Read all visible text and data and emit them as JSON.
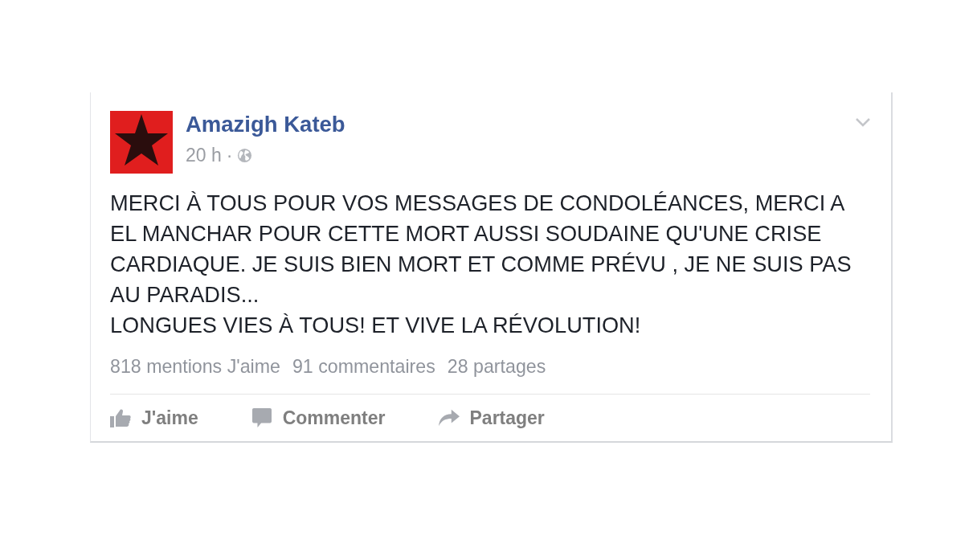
{
  "post": {
    "author": "Amazigh Kateb",
    "time": "20 h",
    "separator": "·",
    "text": "MERCI À TOUS POUR VOS MESSAGES DE CONDOLÉANCES, MERCI A EL MANCHAR POUR CETTE MORT AUSSI SOUDAINE QU'UNE CRISE CARDIAQUE. JE SUIS BIEN MORT ET COMME PRÉVU , JE NE SUIS PAS AU PARADIS...\nLONGUES VIES À TOUS! ET VIVE LA RÉVOLUTION!"
  },
  "stats": [
    "818 mentions J'aime",
    "91 commentaires",
    "28 partages"
  ],
  "actions": [
    {
      "kind": "like",
      "label": "J'aime"
    },
    {
      "kind": "comment",
      "label": "Commenter"
    },
    {
      "kind": "share",
      "label": "Partager"
    }
  ]
}
